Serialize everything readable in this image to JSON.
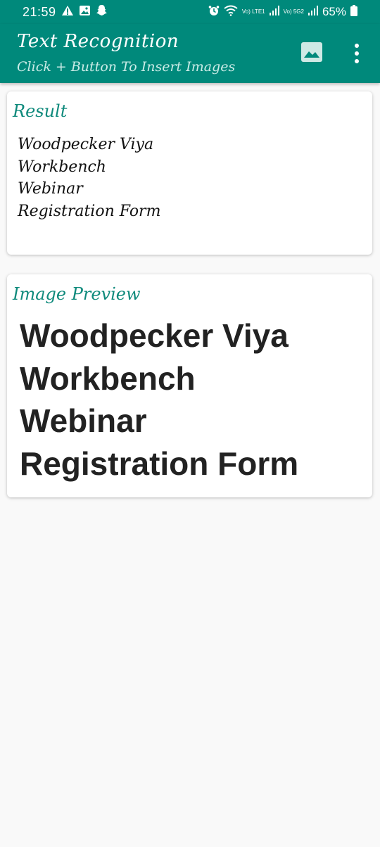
{
  "status_bar": {
    "time": "21:59",
    "left_icons": [
      "warning-icon",
      "gallery-icon",
      "snapchat-icon"
    ],
    "right_icons": [
      "alarm-icon",
      "wifi-icon",
      "signal-icon",
      "signal-icon",
      "battery-icon"
    ],
    "net1": "Vo) LTE1",
    "net2": "Vo) 5G2",
    "battery": "65%"
  },
  "app_bar": {
    "title": "Text Recognition",
    "subtitle": "Click + Button To Insert Images",
    "actions": [
      "image-icon",
      "more-vert-icon"
    ]
  },
  "result_card": {
    "title": "Result",
    "lines": [
      "Woodpecker Viya",
      "Workbench",
      "Webinar",
      "Registration Form"
    ]
  },
  "preview_card": {
    "title": "Image Preview",
    "lines": [
      "Woodpecker Viya",
      "Workbench",
      "Webinar",
      "Registration Form"
    ]
  },
  "colors": {
    "primary": "#00897b",
    "accent_text": "#0f8a7c",
    "background": "#f9f9f9"
  }
}
